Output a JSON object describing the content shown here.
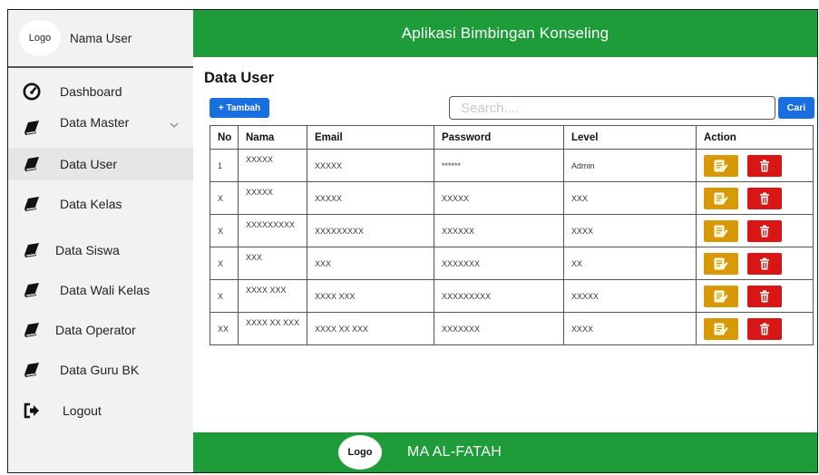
{
  "app": {
    "title": "Aplikasi Bimbingan Konseling"
  },
  "sidebar": {
    "logo": "Logo",
    "user_name": "Nama User",
    "items": [
      {
        "label": "Dashboard",
        "icon": "speedometer-icon"
      },
      {
        "label": "Data Master",
        "icon": "book-icon"
      },
      {
        "label": "Data User",
        "icon": "book-icon"
      },
      {
        "label": "Data Kelas",
        "icon": "book-icon"
      },
      {
        "label": "Data Siswa",
        "icon": "book-icon"
      },
      {
        "label": "Data Wali Kelas",
        "icon": "book-icon"
      },
      {
        "label": "Data Operator",
        "icon": "book-icon"
      },
      {
        "label": "Data Guru BK",
        "icon": "book-icon"
      },
      {
        "label": "Logout",
        "icon": "logout-icon"
      }
    ]
  },
  "main": {
    "title": "Data User",
    "add_label": "+ Tambah",
    "search_placeholder": "Search....",
    "search_button": "Cari",
    "columns": [
      "No",
      "Nama",
      "Email",
      "Password",
      "Level",
      "Action"
    ],
    "rows": [
      [
        "1",
        "XXXXX",
        "XXXXX",
        "******",
        "Admin"
      ],
      [
        "X",
        "XXXXX",
        "XXXXX",
        "XXXXX",
        "XXX"
      ],
      [
        "X",
        "XXXXXXXXX",
        "XXXXXXXXX",
        "XXXXXX",
        "XXXX"
      ],
      [
        "X",
        "XXX",
        "XXX",
        "XXXXXXX",
        "XX"
      ],
      [
        "X",
        "XXXX XXX",
        "XXXX XXX",
        "XXXXXXXXX",
        "XXXXX"
      ],
      [
        "XX",
        "XXXX XX XXX",
        "XXXX XX XXX",
        "XXXXXXX",
        "XXXX"
      ]
    ]
  },
  "footer": {
    "logo": "Logo",
    "name": "MA AL-FATAH"
  },
  "colors": {
    "green": "#1e9c3a",
    "blue": "#1a6fe0",
    "edit": "#d79a06",
    "delete": "#d81616"
  }
}
